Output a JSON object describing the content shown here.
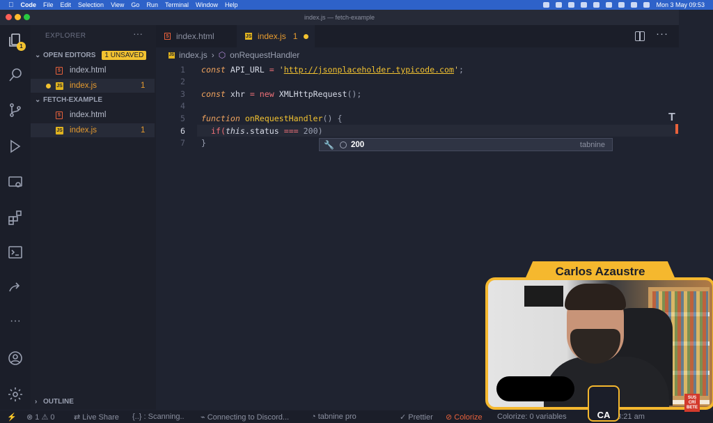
{
  "menubar": {
    "app": "Code",
    "items": [
      "File",
      "Edit",
      "Selection",
      "View",
      "Go",
      "Run",
      "Terminal",
      "Window",
      "Help"
    ],
    "datetime": "Mon 3 May  09:53"
  },
  "window": {
    "title": "index.js — fetch-example"
  },
  "activity": {
    "explorer_badge": "1"
  },
  "sidebar": {
    "title": "EXPLORER",
    "open_editors": {
      "label": "OPEN EDITORS",
      "unsaved": "1 UNSAVED",
      "files": [
        {
          "name": "index.html",
          "type": "html"
        },
        {
          "name": "index.js",
          "type": "js",
          "problems": "1"
        }
      ]
    },
    "folder": {
      "label": "FETCH-EXAMPLE",
      "files": [
        {
          "name": "index.html",
          "type": "html"
        },
        {
          "name": "index.js",
          "type": "js",
          "problems": "1"
        }
      ]
    },
    "outline": "OUTLINE"
  },
  "tabs": [
    {
      "label": "index.html",
      "type": "html",
      "active": false
    },
    {
      "label": "index.js",
      "type": "js",
      "active": true,
      "problems": "1"
    }
  ],
  "breadcrumb": {
    "file": "index.js",
    "symbol": "onRequestHandler"
  },
  "code": {
    "line_numbers": [
      "1",
      "2",
      "3",
      "4",
      "5",
      "6",
      "7"
    ],
    "line1": {
      "k": "const",
      "id": " API_URL ",
      "op": "=",
      "q1": " '",
      "url": "http://jsonplaceholder.typicode.com",
      "q2": "'",
      "end": ";"
    },
    "line3": {
      "k": "const",
      "id": " xhr ",
      "op": "=",
      "sp": " ",
      "new": "new",
      "cls": " XMLHttpRequest",
      "end": "();"
    },
    "line5": {
      "k": "function",
      "fn": " onRequestHandler",
      "end": "() {"
    },
    "line6": {
      "if": "if(",
      "this": "this",
      "prop": ".status ",
      "op": "===",
      "num": " 200",
      "close": ")"
    },
    "line7": {
      "close": "}"
    }
  },
  "suggest": {
    "value": "200",
    "source": "tabnine"
  },
  "status": {
    "errors": "1",
    "warnings": "0",
    "live_share": "Live Share",
    "scanning": "{..} : Scanning..",
    "discord": "Connecting to Discord...",
    "tabnine": "tabnine pro",
    "prettier": "Prettier",
    "colorize": "Colorize",
    "colorize_vars": "Colorize: 0 variables",
    "time": "53:21 am"
  },
  "webcam": {
    "name": "Carlos Azaustre",
    "logo": "CA",
    "subscribe": "SUS CRÍ BETE"
  }
}
